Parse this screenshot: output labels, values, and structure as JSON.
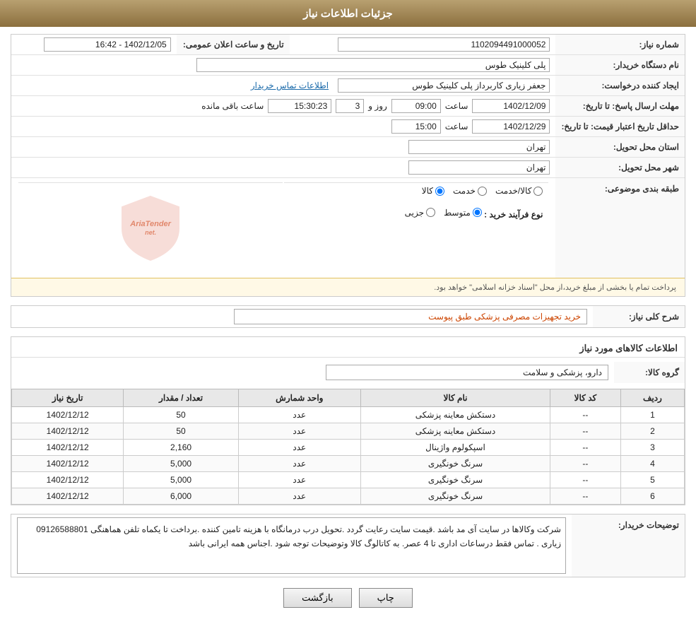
{
  "header": {
    "title": "جزئیات اطلاعات نیاز"
  },
  "fields": {
    "shomara_niaz_label": "شماره نیاز:",
    "shomara_niaz_value": "1102094491000052",
    "nam_dastgah_label": "نام دستگاه خریدار:",
    "nam_dastgah_value": "پلی کلینیک طوس",
    "ijad_konande_label": "ایجاد کننده درخواست:",
    "ijad_konande_value": "جعفر زیاری کاربرداز پلی کلینیک طوس",
    "ejad_link": "اطلاعات تماس خریدار",
    "mohlat_ersal_label": "مهلت ارسال پاسخ: تا تاریخ:",
    "mohlat_date": "1402/12/09",
    "mohlat_saat": "09:00",
    "mohlat_roz": "3",
    "mohlat_baqi": "15:30:23",
    "mohlat_saat_label": "ساعت",
    "mohlat_roz_label": "روز و",
    "mohlat_baqi_label": "ساعت باقی مانده",
    "hadaqal_label": "حداقل تاریخ اعتبار قیمت: تا تاریخ:",
    "hadaqal_date": "1402/12/29",
    "hadaqal_saat": "15:00",
    "ostan_label": "استان محل تحویل:",
    "ostan_value": "تهران",
    "shahr_label": "شهر محل تحویل:",
    "shahr_value": "تهران",
    "tabaqe_label": "طبقه بندی موضوعی:",
    "tabaqe_kala": "کالا",
    "tabaqe_khadamat": "خدمت",
    "tabaqe_kala_khadamat": "کالا/خدمت",
    "tabaqe_selected": "کالا",
    "noe_farayand_label": "نوع فرآیند خرید :",
    "noe_jazii": "جزیی",
    "noe_motavasset": "متوسط",
    "noe_selected": "متوسط",
    "notice_text": "پرداخت تمام یا بخشی از مبلغ خرید،از محل \"اسناد خزانه اسلامی\" خواهد بود.",
    "tarikh_label": "تاریخ و ساعت اعلان عمومی:",
    "tarikh_value": "1402/12/05 - 16:42",
    "shrh_koli_label": "شرح کلی نیاز:",
    "shrh_koli_value": "خرید تجهیزات مصرفی پزشکی طبق پیوست",
    "ettelaat_kala_label": "اطلاعات کالاهای مورد نیاز",
    "goroh_kala_label": "گروه کالا:",
    "goroh_kala_value": "دارو، پزشکی و سلامت",
    "table": {
      "headers": [
        "ردیف",
        "کد کالا",
        "نام کالا",
        "واحد شمارش",
        "تعداد / مقدار",
        "تاریخ نیاز"
      ],
      "rows": [
        {
          "radif": "1",
          "kod": "--",
          "name": "دستکش معاینه پزشکی",
          "vahed": "عدد",
          "tedad": "50",
          "tarikh": "1402/12/12"
        },
        {
          "radif": "2",
          "kod": "--",
          "name": "دستکش معاینه پزشکی",
          "vahed": "عدد",
          "tedad": "50",
          "tarikh": "1402/12/12"
        },
        {
          "radif": "3",
          "kod": "--",
          "name": "اسپکولوم واژینال",
          "vahed": "عدد",
          "tedad": "2,160",
          "tarikh": "1402/12/12"
        },
        {
          "radif": "4",
          "kod": "--",
          "name": "سرنگ خونگیری",
          "vahed": "عدد",
          "tedad": "5,000",
          "tarikh": "1402/12/12"
        },
        {
          "radif": "5",
          "kod": "--",
          "name": "سرنگ خونگیری",
          "vahed": "عدد",
          "tedad": "5,000",
          "tarikh": "1402/12/12"
        },
        {
          "radif": "6",
          "kod": "--",
          "name": "سرنگ خونگیری",
          "vahed": "عدد",
          "tedad": "6,000",
          "tarikh": "1402/12/12"
        }
      ]
    },
    "tozi_label": "توضیحات خریدار:",
    "tozi_value": "شرکت وکالاها در سایت آی مد باشد .قیمت سایت رعایت گردد .تحویل  درب درمانگاه  با هزینه تامین کننده .برداخت تا یکماه تلفن هماهنگی  09126588801 زیاری . تماس فقط درساعات اداری تا 4 عصر. به کاتالوگ کالا وتوضیحات توجه شود .اجناس همه ایرانی باشد",
    "btn_bazgasht": "بازگشت",
    "btn_chap": "چاپ"
  }
}
